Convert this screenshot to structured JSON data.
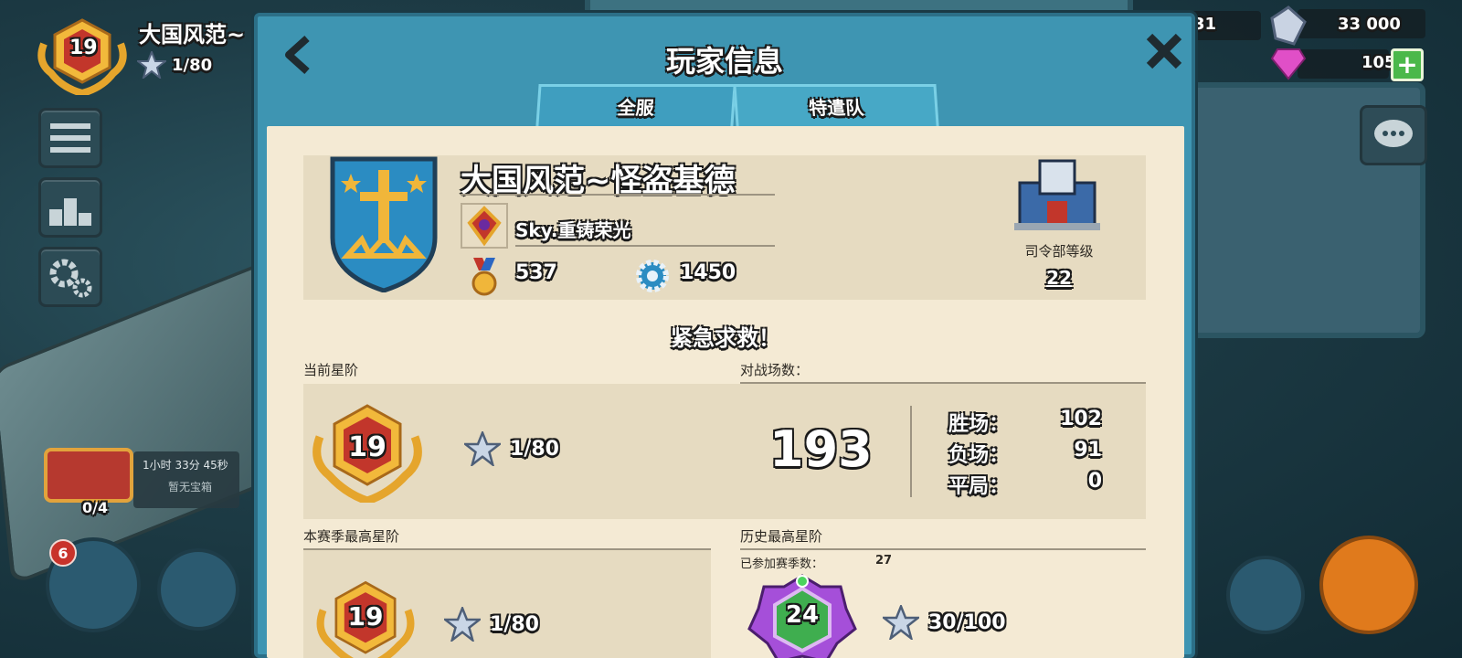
{
  "hud": {
    "player_name": "大国风范~",
    "level": "19",
    "stars": "1/80",
    "resource_partial": "31",
    "resource_iron": "33 000",
    "diamonds": "105",
    "chest_count": "0/4",
    "chest_timer": "1小时 33分 45秒",
    "chest_status": "暂无宝箱",
    "notification_count": "6"
  },
  "modal": {
    "title": "玩家信息",
    "tabs": [
      {
        "label": "全服"
      },
      {
        "label": "特遣队"
      }
    ]
  },
  "profile": {
    "name": "大国风范~怪盗基德",
    "task_force": "Sky.重铸荣光",
    "medals": "537",
    "intel": "1450",
    "hq_label": "司令部等级",
    "hq_level": "22",
    "slogan": "紧急求救！"
  },
  "current_rank": {
    "label": "当前星阶",
    "level": "19",
    "stars": "1/80"
  },
  "battles": {
    "label": "对战场数：",
    "total": "193",
    "wins_label": "胜场：",
    "wins": "102",
    "losses_label": "负场：",
    "losses": "91",
    "draws_label": "平局：",
    "draws": "0"
  },
  "season_best": {
    "label": "本赛季最高星阶",
    "level": "19",
    "stars": "1/80"
  },
  "history_best": {
    "label": "历史最高星阶",
    "seasons_label": "已参加赛季数：",
    "seasons": "27",
    "level": "24",
    "stars": "30/100"
  },
  "colors": {
    "modal_frame": "#3e95b2",
    "parchment": "#f4ead4",
    "card": "#e6dbc1",
    "badge_gold": "#e5a52c",
    "badge_red": "#c2362b",
    "badge_purple": "#a54fd9"
  }
}
